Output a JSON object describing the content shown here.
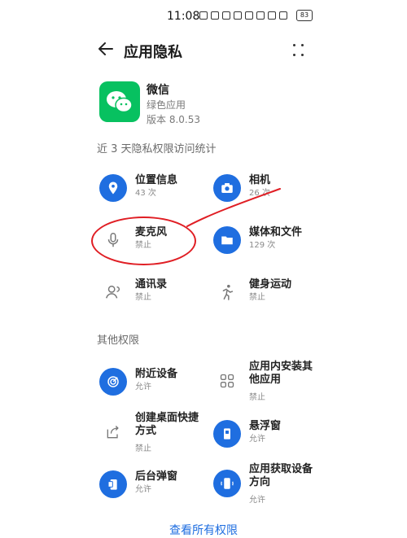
{
  "status": {
    "time": "11:08",
    "battery": "83"
  },
  "header": {
    "title": "应用隐私"
  },
  "app": {
    "name": "微信",
    "category": "绿色应用",
    "version": "版本 8.0.53"
  },
  "sections": {
    "recent_title": "近 3 天隐私权限访问统计",
    "other_title": "其他权限"
  },
  "recent_permissions": [
    {
      "label": "位置信息",
      "count": "43 次",
      "icon": "location-icon",
      "active": true
    },
    {
      "label": "相机",
      "count": "26 次",
      "icon": "camera-icon",
      "active": true
    },
    {
      "label": "麦克风",
      "count": "禁止",
      "icon": "microphone-icon",
      "active": false
    },
    {
      "label": "媒体和文件",
      "count": "129 次",
      "icon": "folder-icon",
      "active": true
    },
    {
      "label": "通讯录",
      "count": "禁止",
      "icon": "contacts-icon",
      "active": false
    },
    {
      "label": "健身运动",
      "count": "禁止",
      "icon": "running-icon",
      "active": false
    }
  ],
  "other_permissions": [
    {
      "label": "附近设备",
      "value": "允许",
      "icon": "nearby-devices-icon",
      "active": true
    },
    {
      "label": "应用内安装其他应用",
      "value": "禁止",
      "icon": "apps-grid-icon",
      "active": false
    },
    {
      "label": "创建桌面快捷方式",
      "value": "禁止",
      "icon": "share-shortcut-icon",
      "active": false
    },
    {
      "label": "悬浮窗",
      "value": "允许",
      "icon": "floating-window-icon",
      "active": true
    },
    {
      "label": "后台弹窗",
      "value": "允许",
      "icon": "background-popup-icon",
      "active": true
    },
    {
      "label": "应用获取设备方向",
      "value": "允许",
      "icon": "device-orientation-icon",
      "active": true
    }
  ],
  "footer": {
    "view_all": "查看所有权限"
  },
  "colors": {
    "accent": "#1f6ee0",
    "annotation": "#e01e24",
    "wechat_green": "#07c160"
  }
}
